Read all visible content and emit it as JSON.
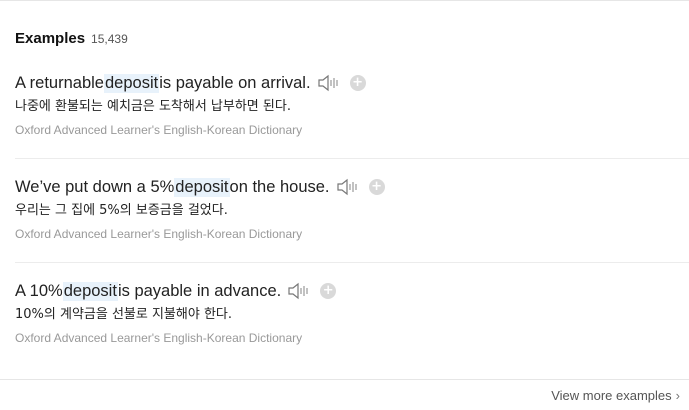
{
  "header": {
    "title": "Examples",
    "count": "15,439"
  },
  "examples": [
    {
      "before": "A returnable ",
      "highlight": "deposit",
      "after": " is payable on arrival.",
      "translation": "나중에 환불되는 예치금은 도착해서 납부하면 된다.",
      "source": "Oxford Advanced Learner's English-Korean Dictionary"
    },
    {
      "before": "We’ve put down a 5% ",
      "highlight": "deposit",
      "after": " on the house.",
      "translation": "우리는 그 집에 5%의 보증금을 걸었다.",
      "source": "Oxford Advanced Learner's English-Korean Dictionary"
    },
    {
      "before": "A 10% ",
      "highlight": "deposit",
      "after": " is payable in advance.",
      "translation": "10%의 계약금을 선불로 지불해야 한다.",
      "source": "Oxford Advanced Learner's English-Korean Dictionary"
    }
  ],
  "footer": {
    "more_label": "View more examples"
  },
  "icons": {
    "speaker": "speaker-icon",
    "add": "plus-circle-icon",
    "chevron": "chevron-right-icon"
  },
  "colors": {
    "highlight": "#e8f2fb",
    "muted": "#999999"
  }
}
